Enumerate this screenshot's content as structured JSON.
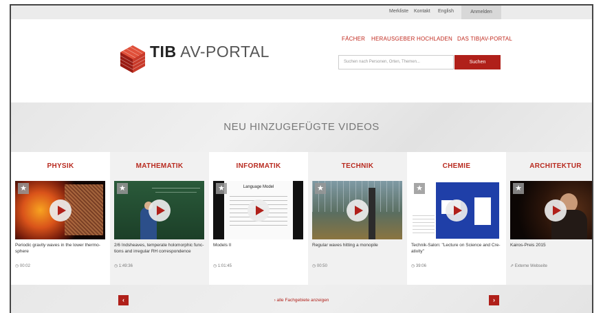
{
  "topbar": {
    "merkliste": "Merkliste",
    "kontakt": "Kontakt",
    "english": "English",
    "anmelden": "Anmelden"
  },
  "logo": {
    "bold": "TIB",
    "light": " AV-PORTAL"
  },
  "nav": [
    "FÄCHER",
    "HERAUSGEBER",
    "HOCHLADEN",
    "DAS TIB|AV-PORTAL"
  ],
  "search": {
    "placeholder": "Suchen nach Personen, Orten, Themen...",
    "button": "Suchen"
  },
  "hero": {
    "title": "NEU HINZUGEFÜGTE VIDEOS"
  },
  "cards": [
    {
      "category": "PHYSIK",
      "title": "Periodic gravity waves in the lower thermo-sphere",
      "meta": "00:02"
    },
    {
      "category": "MATHEMATIK",
      "title": "2/6 Indsheaves, temperate holomorphic func-tions and irregular RH correspondence",
      "meta": "1:49:36"
    },
    {
      "category": "INFORMATIK",
      "title": "Models II",
      "meta": "1:01:45",
      "thumb_heading": "Language Model"
    },
    {
      "category": "TECHNIK",
      "title": "Regular waves hitting a monopile",
      "meta": "00:50"
    },
    {
      "category": "CHEMIE",
      "title": "Technik-Salon: \"Lecture on Science and Cre-ativity\"",
      "meta": "39:06"
    },
    {
      "category": "ARCHITEKTUR",
      "title": "Kairos-Preis 2015",
      "meta": "Externe Webseite"
    }
  ],
  "bottom": {
    "link": "› alle Fachgebiete anzeigen",
    "prev": "‹",
    "next": "›"
  },
  "colors": {
    "accent": "#b0201a",
    "category": "#b82a1f"
  }
}
